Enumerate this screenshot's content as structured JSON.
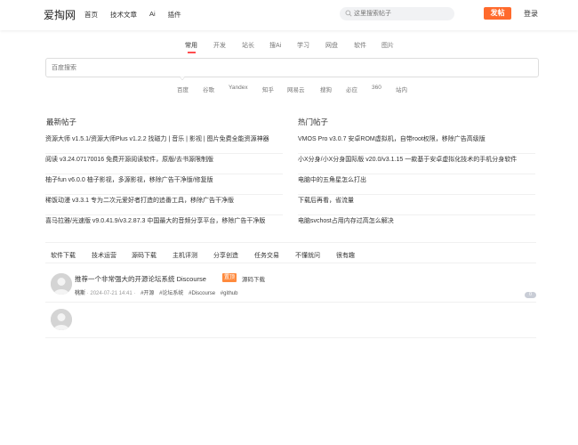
{
  "header": {
    "logo": "爱掏网",
    "nav": [
      "首页",
      "技术文章",
      "Ai",
      "插件"
    ],
    "search_placeholder": "这里搜索帖子",
    "post_button": "发帖",
    "login": "登录",
    "accent_color": "#ff6a2c"
  },
  "search": {
    "tabs": [
      "常用",
      "开发",
      "站长",
      "搜Ai",
      "学习",
      "网盘",
      "软件",
      "图片"
    ],
    "active_tab": "常用",
    "placeholder": "百度搜索",
    "engines": [
      "百度",
      "谷歌",
      "Yandex",
      "知乎",
      "网易云",
      "搜狗",
      "必应",
      "360",
      "站内"
    ]
  },
  "latest": {
    "title": "最新帖子",
    "items": [
      "资源大师 v1.5.1/资源大师Plus v1.2.2 找磁力 | 音乐 | 影视 | 图片免费全能资源神器",
      "阅读 v3.24.07170016 免费开源阅读软件，原版/去书源限制版",
      "柚子fun v6.0.0 柚子影视，多源影视，移除广告干净版/修复版",
      "稀饭动漫 v3.3.1 专为二次元爱好者打造的追番工具，移除广告干净版",
      "喜马拉雅/光速版 v9.0.41.9/v3.2.87.3 中国最大的音频分享平台，移除广告干净版"
    ]
  },
  "hot": {
    "title": "热门帖子",
    "items": [
      "VMOS Pro v3.0.7 安卓ROM虚拟机，自带root权限，移除广告高级版",
      "小X分身/小X分身国际版 v20.0/v3.1.15 一款基于安卓虚拟化技术的手机分身软件",
      "电脑中的五角星怎么打出",
      "下载后再看，省流量",
      "电脑svchost占用内存过高怎么解决"
    ]
  },
  "categories": [
    "软件下载",
    "技术运营",
    "源码下载",
    "主机评测",
    "分享创造",
    "任务交易",
    "不懂就问",
    "很有趣"
  ],
  "threads": [
    {
      "title": "推荐一个非常强大的开源论坛系统 Discourse",
      "badge": "置顶",
      "category": "源码下载",
      "author": "桃斯",
      "date": "2024-07-21 14:41",
      "tags": [
        "#开源",
        "#论坛系统",
        "#Discourse",
        "#github"
      ],
      "replies": "0"
    }
  ]
}
